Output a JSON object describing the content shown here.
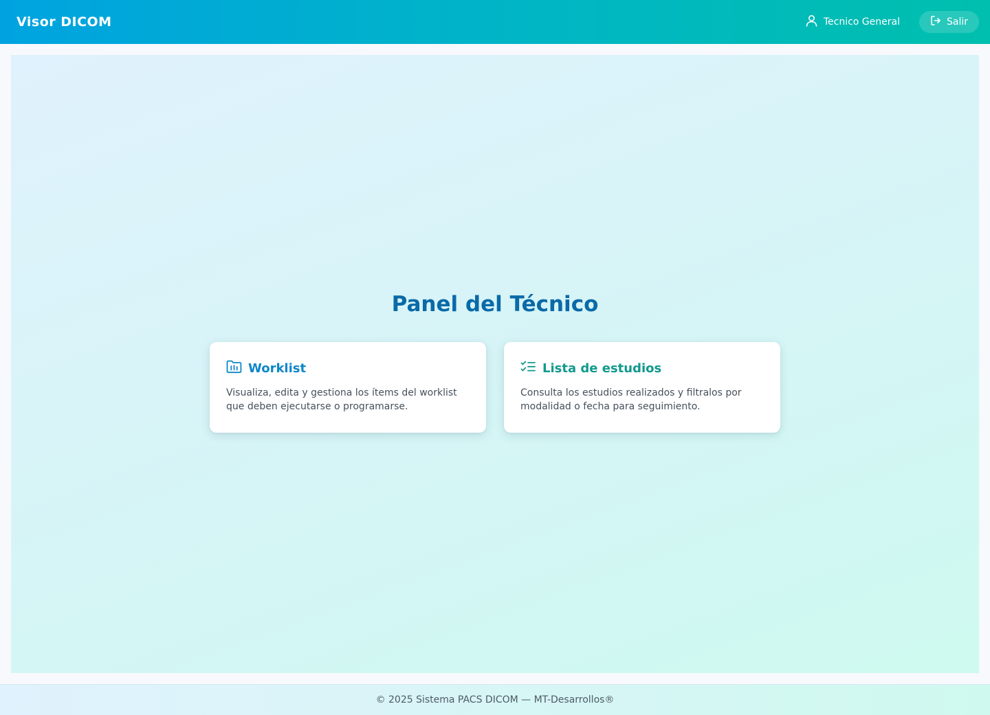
{
  "header": {
    "brand": "Visor DICOM",
    "user_name": "Tecnico General",
    "user_icon": "user-icon",
    "logout_label": "Salir",
    "logout_icon": "logout-icon"
  },
  "main": {
    "title": "Panel del Técnico",
    "cards": [
      {
        "icon": "folder-icon",
        "title": "Worklist",
        "description": "Visualiza, edita y gestiona los ítems del worklist que deben ejecutarse o programarse."
      },
      {
        "icon": "checklist-icon",
        "title": "Lista de estudios",
        "description": "Consulta los estudios realizados y filtralos por modalidad o fecha para seguimiento."
      }
    ]
  },
  "footer": {
    "text": "© 2025 Sistema PACS DICOM — MT-Desarrollos®"
  },
  "colors": {
    "header_gradient_start": "#00a3e0",
    "header_gradient_end": "#00bfae",
    "title_color": "#0a6aa8",
    "worklist_accent": "#0d86c9",
    "estudios_accent": "#11998e"
  }
}
